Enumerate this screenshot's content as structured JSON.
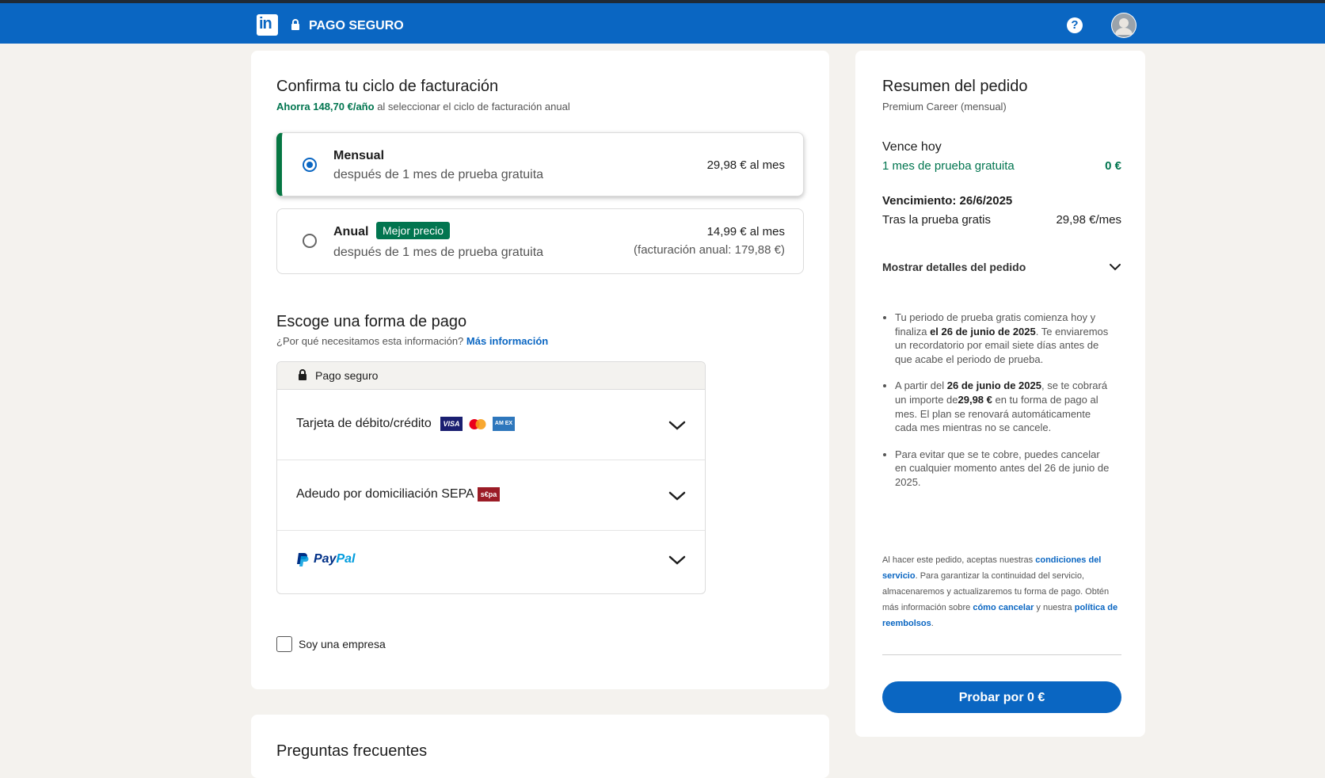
{
  "header": {
    "logo_text": "in",
    "title": "PAGO SEGURO",
    "help_glyph": "?",
    "icons": [
      "linkedin-logo",
      "lock-icon",
      "help-icon",
      "avatar"
    ],
    "brand_color": "#0a66c2"
  },
  "billing": {
    "title": "Confirma tu ciclo de facturación",
    "savings_highlight": "Ahorra 148,70 €/año",
    "savings_rest": "al seleccionar el ciclo de facturación anual",
    "options": [
      {
        "title": "Mensual",
        "subtitle": "después de 1 mes de prueba gratuita",
        "price": "29,98 € al mes",
        "selected": true
      },
      {
        "title": "Anual",
        "badge": "Mejor precio",
        "subtitle": "después de 1 mes de prueba gratuita",
        "price": "14,99 € al mes",
        "price_note": "(facturación anual: 179,88 €)",
        "selected": false
      }
    ]
  },
  "payment": {
    "title": "Escoge una forma de pago",
    "question": "¿Por qué necesitamos esta información?",
    "more_info": "Más información",
    "secure_label": "Pago seguro",
    "methods": [
      {
        "label": "Tarjeta de débito/crédito",
        "card_brands": [
          "VISA",
          "Mastercard",
          "AMEX"
        ]
      },
      {
        "label": "Adeudo por domiciliación SEPA",
        "sepa_logo": "SEPA"
      },
      {
        "label": "PayPal"
      }
    ],
    "visa_text": "VISA",
    "amex_text": "AM EX",
    "sepa_text": "s€pa",
    "paypal_pay": "Pay",
    "paypal_pal": "Pal"
  },
  "company_checkbox": {
    "label": "Soy una empresa",
    "checked": false
  },
  "faq": {
    "title": "Preguntas frecuentes"
  },
  "summary": {
    "title": "Resumen del pedido",
    "plan": "Premium Career (mensual)",
    "due_today_label": "Vence hoy",
    "trial_label": "1 mes de prueba gratuita",
    "trial_price": "0 €",
    "due_date_label": "Vencimiento: 26/6/2025",
    "after_trial_label": "Tras la prueba gratis",
    "after_trial_price": "29,98 €/mes",
    "details_toggle": "Mostrar detalles del pedido",
    "bullets": [
      {
        "a": "Tu periodo de prueba gratis comienza hoy y finaliza ",
        "b": "el 26 de junio de 2025",
        "c": ". Te enviaremos un recordatorio por email siete días antes de que acabe el periodo de prueba."
      },
      {
        "a": "A partir del ",
        "b": "26 de junio de 2025",
        "c": ", se te cobrará un importe de",
        "d": "29,98 €",
        "e": " en tu forma de pago al mes. El plan se renovará automáticamente cada mes mientras no se cancele."
      },
      {
        "a": "Para evitar que se te cobre, puedes cancelar en cualquier momento antes del 26 de junio de 2025."
      }
    ],
    "legal": {
      "p1": "Al hacer este pedido, aceptas nuestras ",
      "l1": "condiciones del servicio",
      "p2": ". Para garantizar la continuidad del servicio, almacenaremos y actualizaremos tu forma de pago. Obtén más información sobre ",
      "l2": "cómo cancelar",
      "p3": " y nuestra ",
      "l3": "política de reembolsos",
      "p4": "."
    },
    "cta": "Probar por 0 €"
  }
}
